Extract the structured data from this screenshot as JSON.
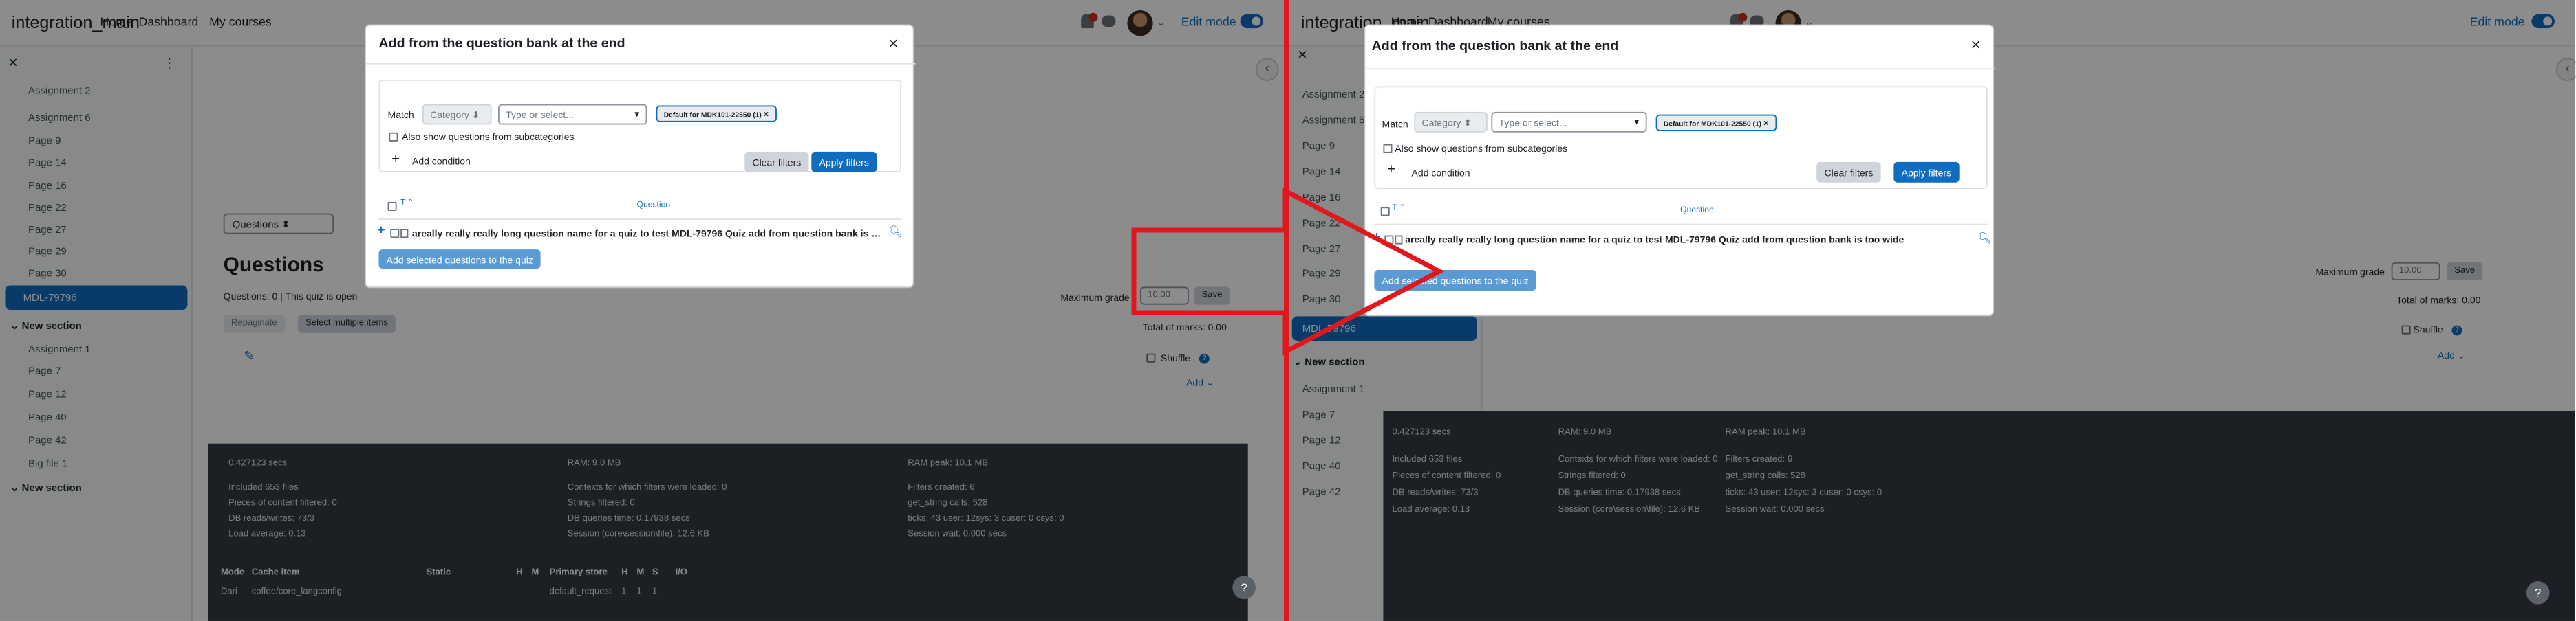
{
  "navbar": {
    "brand": "integration_main",
    "links": [
      "Home",
      "Dashboard",
      "My courses"
    ],
    "edit_mode_label": "Edit mode"
  },
  "drawer": {
    "items_top": [
      "Assignment 2",
      "Assignment 6",
      "Page 9",
      "Page 14",
      "Page 16",
      "Page 22",
      "Page 27",
      "Page 29",
      "Page 30"
    ],
    "active_item": "MDL-79796",
    "section_1": "New section",
    "items_section1_left": [
      "Assignment 1",
      "Page 7",
      "Page 12",
      "Page 40",
      "Page 42",
      "Big file 1"
    ],
    "items_section1_right": [
      "Assignment 1",
      "Page 7",
      "Page 12",
      "Page 40",
      "Page 42"
    ],
    "section_2": "New section"
  },
  "main": {
    "select_value": "Questions",
    "heading": "Questions",
    "heading_right": "Question",
    "status": "Questions: 0 | This quiz is open",
    "max_grade_label": "Maximum grade",
    "max_grade_value": "10.00",
    "save_label": "Save",
    "total_marks": "Total of marks: 0.00",
    "repaginate_label": "Repaginate",
    "select_multiple_label": "Select multiple items",
    "shuffle_label": "Shuffle",
    "add_label": "Add"
  },
  "footer": {
    "col1": [
      "0.427123 secs",
      "Included 653 files",
      "Pieces of content filtered: 0",
      "DB reads/writes: 73/3",
      "Load average: 0.13"
    ],
    "col2": [
      "RAM: 9.0 MB",
      "Contexts for which filters were loaded: 0",
      "Strings filtered: 0",
      "DB queries time: 0.17938 secs",
      "Session (core\\session\\file): 12.6 KB"
    ],
    "col3": [
      "RAM peak: 10.1 MB",
      "Filters created: 6",
      "get_string calls: 528",
      "ticks: 43 user: 12sys: 3 cuser: 0 csys: 0",
      "Session wait: 0.000 secs"
    ],
    "col3_right_line4": "ticks: 43 user: 12sys: 3 cuser: 0 csys: 0",
    "table_headers": [
      "Mode",
      "Cache item",
      "Static",
      "H",
      "M",
      "Primary store",
      "H",
      "M",
      "S",
      "I/O"
    ],
    "table_row_partial": [
      "Dari",
      "coffee/core_langconfig",
      "",
      "",
      "",
      "default_request",
      "1",
      "1",
      "1",
      ""
    ]
  },
  "modal": {
    "title": "Add from the question bank at the end",
    "match_label": "Match",
    "category_label": "Category",
    "type_placeholder": "Type or select...",
    "pill_label": "Default for MDK101-22550 (1)",
    "subcategories_label": "Also show questions from subcategories",
    "add_condition_label": "Add condition",
    "clear_filters_label": "Clear filters",
    "apply_filters_label": "Apply filters",
    "sort_label": "T",
    "question_col_label": "Question",
    "question_name": "areally really really long question name for a quiz to test MDL-79796 Quiz add from question bank is too wide",
    "add_selected_label": "Add selected questions to the quiz"
  },
  "colors": {
    "accent": "#0f6cbf",
    "divider_and_arrow": "#e0171d",
    "footer_bg": "#343a40"
  },
  "icons": [
    "bell-icon",
    "chat-icon",
    "avatar",
    "close-icon",
    "kebab-icon",
    "chevron-left-icon",
    "pencil-icon",
    "info-icon",
    "search-icon",
    "plus-icon",
    "help-icon"
  ]
}
